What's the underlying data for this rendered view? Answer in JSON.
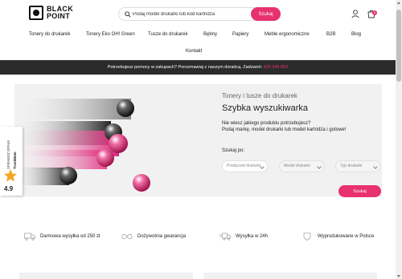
{
  "brand": {
    "logo_line1": "BLACK",
    "logo_line2": "POINT"
  },
  "search": {
    "placeholder": "Podaj model drukarki lub kod kartridża",
    "button_label": "Szukaj"
  },
  "header_icons": {
    "user": "user-icon",
    "cart": "cart-icon",
    "cart_count": "0"
  },
  "nav": {
    "items": [
      {
        "label": "Tonery do drukarek"
      },
      {
        "label": "Tonery Eko OH! Green"
      },
      {
        "label": "Tusze do drukarek"
      },
      {
        "label": "Bębny"
      },
      {
        "label": "Papiery"
      },
      {
        "label": "Meble ergonomiczne"
      },
      {
        "label": "B2B"
      },
      {
        "label": "Blog"
      },
      {
        "label": "Kontakt"
      }
    ]
  },
  "topbar": {
    "text": "Potrzebujesz pomocy w zakupach? Porozmawiaj z naszym doradcą. Zadzwoń: ",
    "phone": "609 345 802"
  },
  "hero": {
    "subtitle": "Tonery i tusze do drukarek",
    "title": "Szybka wyszukiwarka",
    "desc_line1": "Nie wiesz jakiego produktu potrzebujesz?",
    "desc_line2": "Podaj markę, model drukarki lub model kartridża i gotowe!",
    "find_label": "Szukaj po:",
    "selects": [
      {
        "placeholder": "Producent drukarki"
      },
      {
        "placeholder": "Model drukarki"
      },
      {
        "placeholder": "Typ drukarki"
      }
    ],
    "button_label": "Szukaj"
  },
  "trust_badge": {
    "label": "SPRAWDŹ OPINIE",
    "brand": "TrustMate",
    "score": "4.9"
  },
  "features": [
    {
      "icon": "truck-icon",
      "label": "Darmowa wysyłka od 250 zł"
    },
    {
      "icon": "infinity-icon",
      "label": "Dożywotnia gwarancja"
    },
    {
      "icon": "fast-delivery-icon",
      "label": "Wysyłka w 24h"
    },
    {
      "icon": "shield-icon",
      "label": "Wyprodukowane w Polsce"
    }
  ],
  "colors": {
    "accent": "#e8316f",
    "dark_bar": "#2b2b2b",
    "hero_bg": "#f1f1f1"
  }
}
